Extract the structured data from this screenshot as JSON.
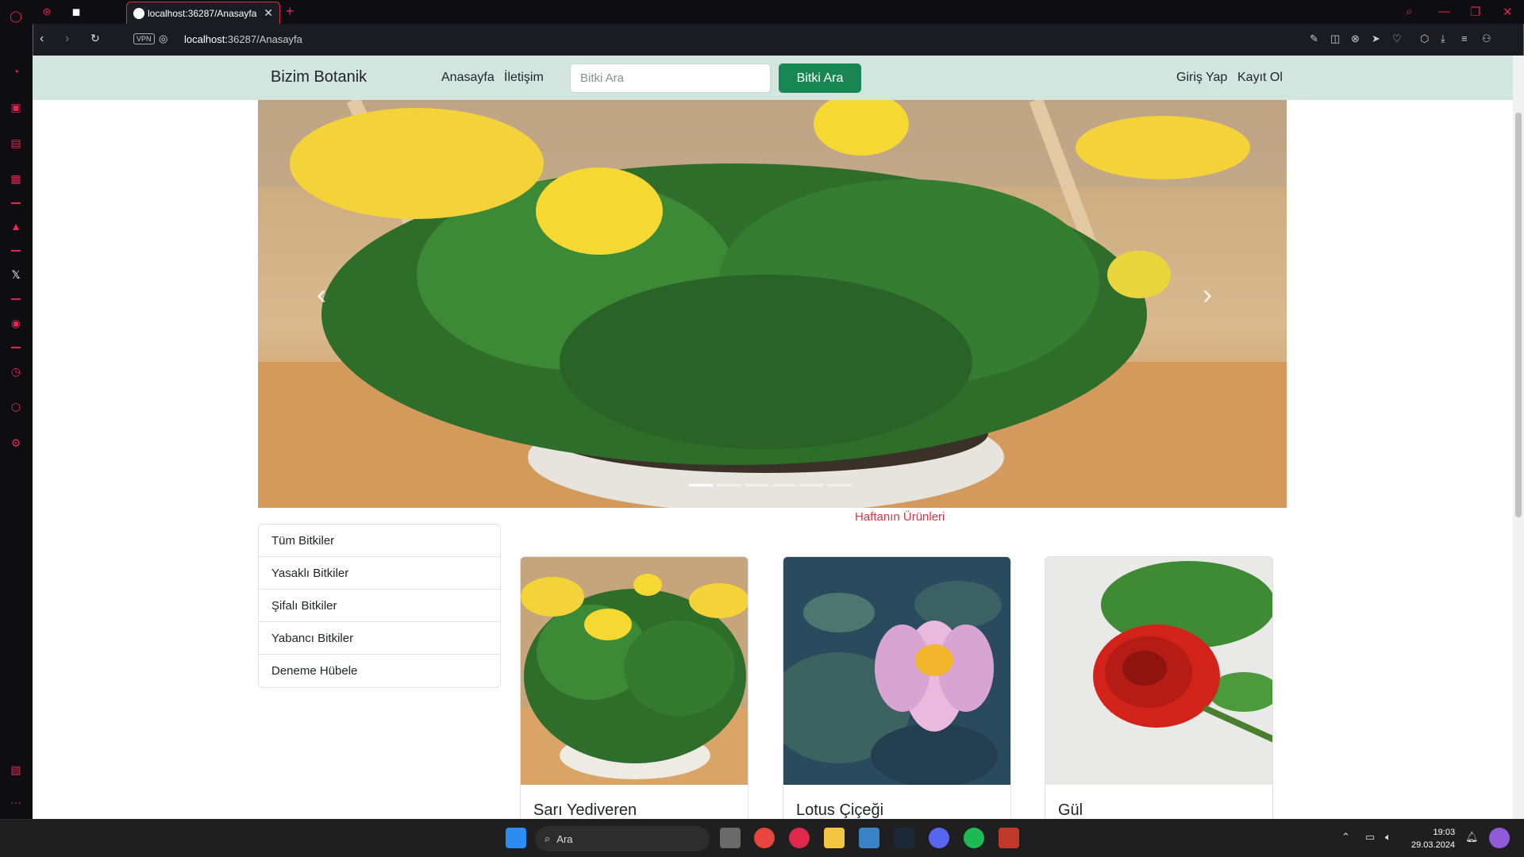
{
  "browser": {
    "tab_title": "localhost:36287/Anasayfa",
    "url_host": "localhost:",
    "url_path": "36287/Anasayfa",
    "vpn_label": "VPN",
    "accent_color": "#e0284f"
  },
  "site": {
    "brand": "Bizim Botanik",
    "nav": {
      "home": "Anasayfa",
      "contact": "İletişim",
      "login": "Giriş Yap",
      "register": "Kayıt Ol"
    },
    "search": {
      "placeholder": "Bitki Ara",
      "button": "Bitki Ara"
    },
    "carousel": {
      "slide_count": 6,
      "active_index": 0
    },
    "categories": [
      {
        "label": "Tüm Bitkiler"
      },
      {
        "label": "Yasaklı Bitkiler"
      },
      {
        "label": "Şifalı Bitkiler"
      },
      {
        "label": "Yabancı Bitkiler"
      },
      {
        "label": "Deneme Hübele"
      }
    ],
    "weekly_title": "Haftanın Ürünleri",
    "products": [
      {
        "name": "Sarı Yediveren"
      },
      {
        "name": "Lotus Çiçeği"
      },
      {
        "name": "Gül"
      }
    ],
    "colors": {
      "navbar_bg": "#d2e6df",
      "search_button": "#198754",
      "weekly_title": "#dc3545"
    }
  },
  "taskbar": {
    "search_label": "Ara",
    "time": "19:03",
    "date": "29.03.2024"
  }
}
